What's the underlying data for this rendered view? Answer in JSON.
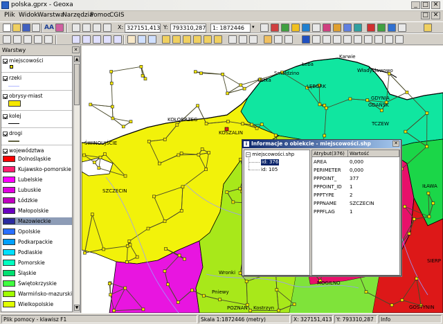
{
  "window": {
    "title": "polska.gprx - Geoxa"
  },
  "menu": [
    "Plik",
    "Widok",
    "Warstwa",
    "Narzędzia",
    "Pomoc",
    "CGIS"
  ],
  "toolbar": {
    "x_label": "X:",
    "x_value": "327151,413",
    "y_label": "Y:",
    "y_value": "793310,287",
    "scale_value": "1: 1872446",
    "text_tool_label": "AA"
  },
  "layers_panel": {
    "header": "Warstwy",
    "layers": [
      {
        "name": "miejscowości",
        "checked": true
      },
      {
        "name": "rzeki",
        "checked": true
      },
      {
        "name": "obrysy-miast",
        "checked": true
      },
      {
        "name": "kolej",
        "checked": true
      },
      {
        "name": "drogi",
        "checked": true
      },
      {
        "name": "województwa",
        "checked": true
      }
    ],
    "legend": [
      {
        "label": "Dolnośląskie",
        "color": "#ff0000"
      },
      {
        "label": "Kujawsko-pomorskie",
        "color": "#ff2070"
      },
      {
        "label": "Lubelskie",
        "color": "#ff00ff"
      },
      {
        "label": "Lubuskie",
        "color": "#e000e0"
      },
      {
        "label": "Łódzkie",
        "color": "#c000c0"
      },
      {
        "label": "Małopolskie",
        "color": "#6a00c0"
      },
      {
        "label": "Mazowieckie",
        "color": "#2a2aa0"
      },
      {
        "label": "Opolskie",
        "color": "#2a70ff"
      },
      {
        "label": "Podkarpackie",
        "color": "#00a0ff"
      },
      {
        "label": "Podlaskie",
        "color": "#00e0ff"
      },
      {
        "label": "Pomorskie",
        "color": "#00ffc0"
      },
      {
        "label": "Śląskie",
        "color": "#00e070"
      },
      {
        "label": "Świętokrzyskie",
        "color": "#40ff40"
      },
      {
        "label": "Warmińsko-mazurskie",
        "color": "#a0ff00"
      },
      {
        "label": "Wielkopolskie",
        "color": "#e0ff00"
      }
    ],
    "selected_legend": "Mazowieckie"
  },
  "map": {
    "labels": [
      "Karwie",
      "Łeba",
      "Władysławowo",
      "Smołdzino",
      "Ustka",
      "LĘBORK",
      "GDYNIA",
      "GDAŃSK",
      "TCZEW",
      "KOŁOBRZEG",
      "KOSZALIN",
      "ŚWINOUJŚCIE",
      "SZCZECIN",
      "IŁAWA",
      "Wronki",
      "Pniewy",
      "POZNAŃ",
      "Kostrzyn",
      "MOGILNO",
      "GOSTYNIN",
      "SIERP"
    ],
    "colors": {
      "zachodniopomorskie": "#f2f20a",
      "pomorskie": "#10e6a0",
      "lubuskie": "#e815e0",
      "wielkopolskie": "#a8e81a",
      "kujawsko": "#e8106a",
      "warminsko": "#1bd648",
      "mazowieckie": "#dd1818"
    }
  },
  "info_dialog": {
    "title": "Informacje o obiekcie - miejscowości.shp",
    "tree": {
      "root": "miejscowości.shp",
      "items": [
        "id: 376",
        "id: 105"
      ],
      "selected": "id: 376"
    },
    "grid": {
      "col_attr": "Atrybut(376)",
      "col_val": "Wartość",
      "rows": [
        {
          "attr": "AREA",
          "value": "0,000"
        },
        {
          "attr": "PERIMETER",
          "value": "0,000"
        },
        {
          "attr": "PPPOINT_",
          "value": "377"
        },
        {
          "attr": "PPPOINT_ID",
          "value": "1"
        },
        {
          "attr": "PPPTYPE",
          "value": "2"
        },
        {
          "attr": "PPPNAME",
          "value": "SZCZECIN"
        },
        {
          "attr": "PPPFLAG",
          "value": "1"
        }
      ]
    }
  },
  "statusbar": {
    "help": "Plik pomocy - klawisz F1",
    "scale": "Skala 1:1872446 (metry)",
    "x": "X: 327151,413",
    "y": "Y: 793310,287",
    "info": "Info"
  }
}
